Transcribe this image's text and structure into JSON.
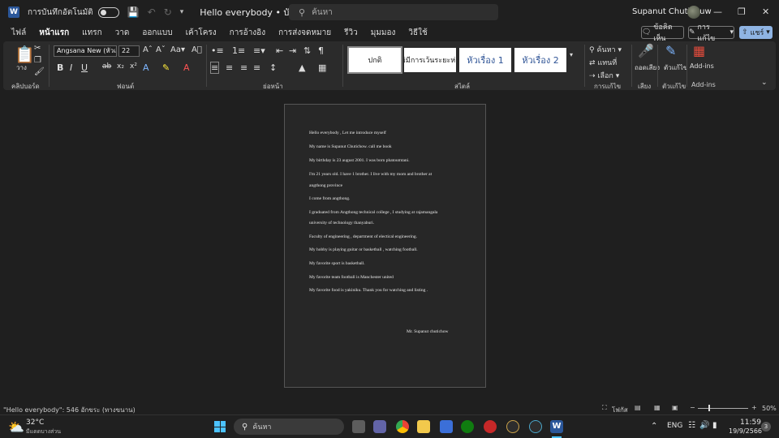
{
  "titlebar": {
    "autosave_label": "การบันทึกอัตโนมัติ",
    "doc_title": "Hello everybody • บันทึกไปยัง พีซีนี้",
    "search_placeholder": "ค้นหา",
    "user_name": "Supanut Chutichuw"
  },
  "tabs": [
    "ไฟล์",
    "หน้าแรก",
    "แทรก",
    "วาด",
    "ออกแบบ",
    "เค้าโครง",
    "การอ้างอิง",
    "การส่งจดหมาย",
    "รีวิว",
    "มุมมอง",
    "วิธีใช้"
  ],
  "actions": {
    "comments": "ข้อคิดเห็น",
    "editing": "การแก้ไข",
    "share": "แชร์"
  },
  "ribbon": {
    "clipboard_label": "คลิปบอร์ด",
    "paste_label": "วาง",
    "font_label": "ฟอนต์",
    "font_name": "Angsana New (หัวเรื่อ",
    "font_size": "22",
    "paragraph_label": "ย่อหน้า",
    "styles_label": "สไตล์",
    "styles": [
      "ปกติ",
      "ไม่มีการเว้นระยะห่าง",
      "หัวเรื่อง 1",
      "หัวเรื่อง 2"
    ],
    "find": "ค้นหา",
    "replace": "แทนที่",
    "select": "เลือก",
    "editing_label": "การแก้ไข",
    "dictate": "ถอดเสียง",
    "voice_label": "เสียง",
    "editor": "ตัวแก้ไข",
    "editor_label": "ตัวแก้ไข",
    "addins": "Add-ins",
    "addins_label": "Add-ins"
  },
  "document": {
    "lines": [
      "Hello everybody , Let me introduce myself",
      "My name is Supanut Chutichow. call me book",
      "My birthday is 23 august 2001. I was born phatoumtani.",
      "I'm 21 years old. I have 1 brother. I live with my mom and brother at",
      "angthong province",
      "I come from angthong.",
      "I graduated from Angthong technical college , I studying at rajamangala",
      "university of technology thanyaburi.",
      "Faculty of engineering , department of electical engineering.",
      "My hobby is playing guitar or basketball , watching football.",
      "My favorite sport is basketball.",
      "My favorite team football is Manchester united",
      "My favorite food is yakiniku. Thank you for watching and listing ."
    ],
    "signature": "Mr. Supanut chutichow"
  },
  "status": {
    "word_count": "\"Hello everybody\": 546 อักขระ (ทางขนาน)",
    "focus": "โฟกัส",
    "zoom": "50%"
  },
  "taskbar": {
    "temp": "32°C",
    "weather": "มีแดดบางส่วน",
    "search": "ค้นหา",
    "lang": "ENG",
    "time": "11:59",
    "date": "19/9/2566",
    "badge": "3"
  }
}
